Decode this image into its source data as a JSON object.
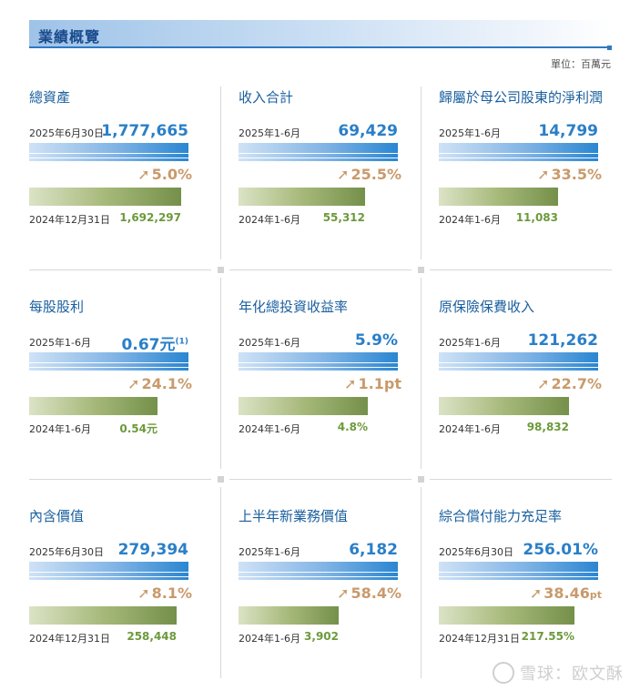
{
  "header": {
    "title": "業績概覽"
  },
  "unit_label": "單位：百萬元",
  "metrics": [
    {
      "name": "總資產",
      "cur_label": "2025年6月30日",
      "cur_value": "1,777,665",
      "growth": "5.0%",
      "prev_label": "2024年12月31日",
      "prev_value": "1,692,297",
      "prev_ratio": 0.952
    },
    {
      "name": "收入合計",
      "cur_label": "2025年1-6月",
      "cur_value": "69,429",
      "growth": "25.5%",
      "prev_label": "2024年1-6月",
      "prev_value": "55,312",
      "prev_ratio": 0.797
    },
    {
      "name": "歸屬於母公司股東的淨利潤",
      "cur_label": "2025年1-6月",
      "cur_value": "14,799",
      "growth": "33.5%",
      "prev_label": "2024年1-6月",
      "prev_value": "11,083",
      "prev_ratio": 0.749
    },
    {
      "name": "每股股利",
      "cur_label": "2025年1-6月",
      "cur_value": "0.67元",
      "cur_sup": "(1)",
      "growth": "24.1%",
      "prev_label": "2024年1-6月",
      "prev_value": "0.54元",
      "prev_ratio": 0.806
    },
    {
      "name": "年化總投資收益率",
      "cur_label": "2025年1-6月",
      "cur_value": "5.9%",
      "growth": "1.1pt",
      "prev_label": "2024年1-6月",
      "prev_value": "4.8%",
      "prev_ratio": 0.814
    },
    {
      "name": "原保險保費收入",
      "cur_label": "2025年1-6月",
      "cur_value": "121,262",
      "growth": "22.7%",
      "prev_label": "2024年1-6月",
      "prev_value": "98,832",
      "prev_ratio": 0.815
    },
    {
      "name": "內含價值",
      "cur_label": "2025年6月30日",
      "cur_value": "279,394",
      "growth": "8.1%",
      "prev_label": "2024年12月31日",
      "prev_value": "258,448",
      "prev_ratio": 0.925
    },
    {
      "name": "上半年新業務價值",
      "cur_label": "2025年1-6月",
      "cur_value": "6,182",
      "growth": "58.4%",
      "prev_label": "2024年1-6月",
      "prev_value": "3,902",
      "prev_ratio": 0.631
    },
    {
      "name": "綜合償付能力充足率",
      "cur_label": "2025年6月30日",
      "cur_value": "256.01%",
      "growth": "38.46",
      "growth_unit": "pt",
      "prev_label": "2024年12月31日",
      "prev_value": "217.55%",
      "prev_ratio": 0.85
    }
  ],
  "watermark": "雪球：欧文酥"
}
